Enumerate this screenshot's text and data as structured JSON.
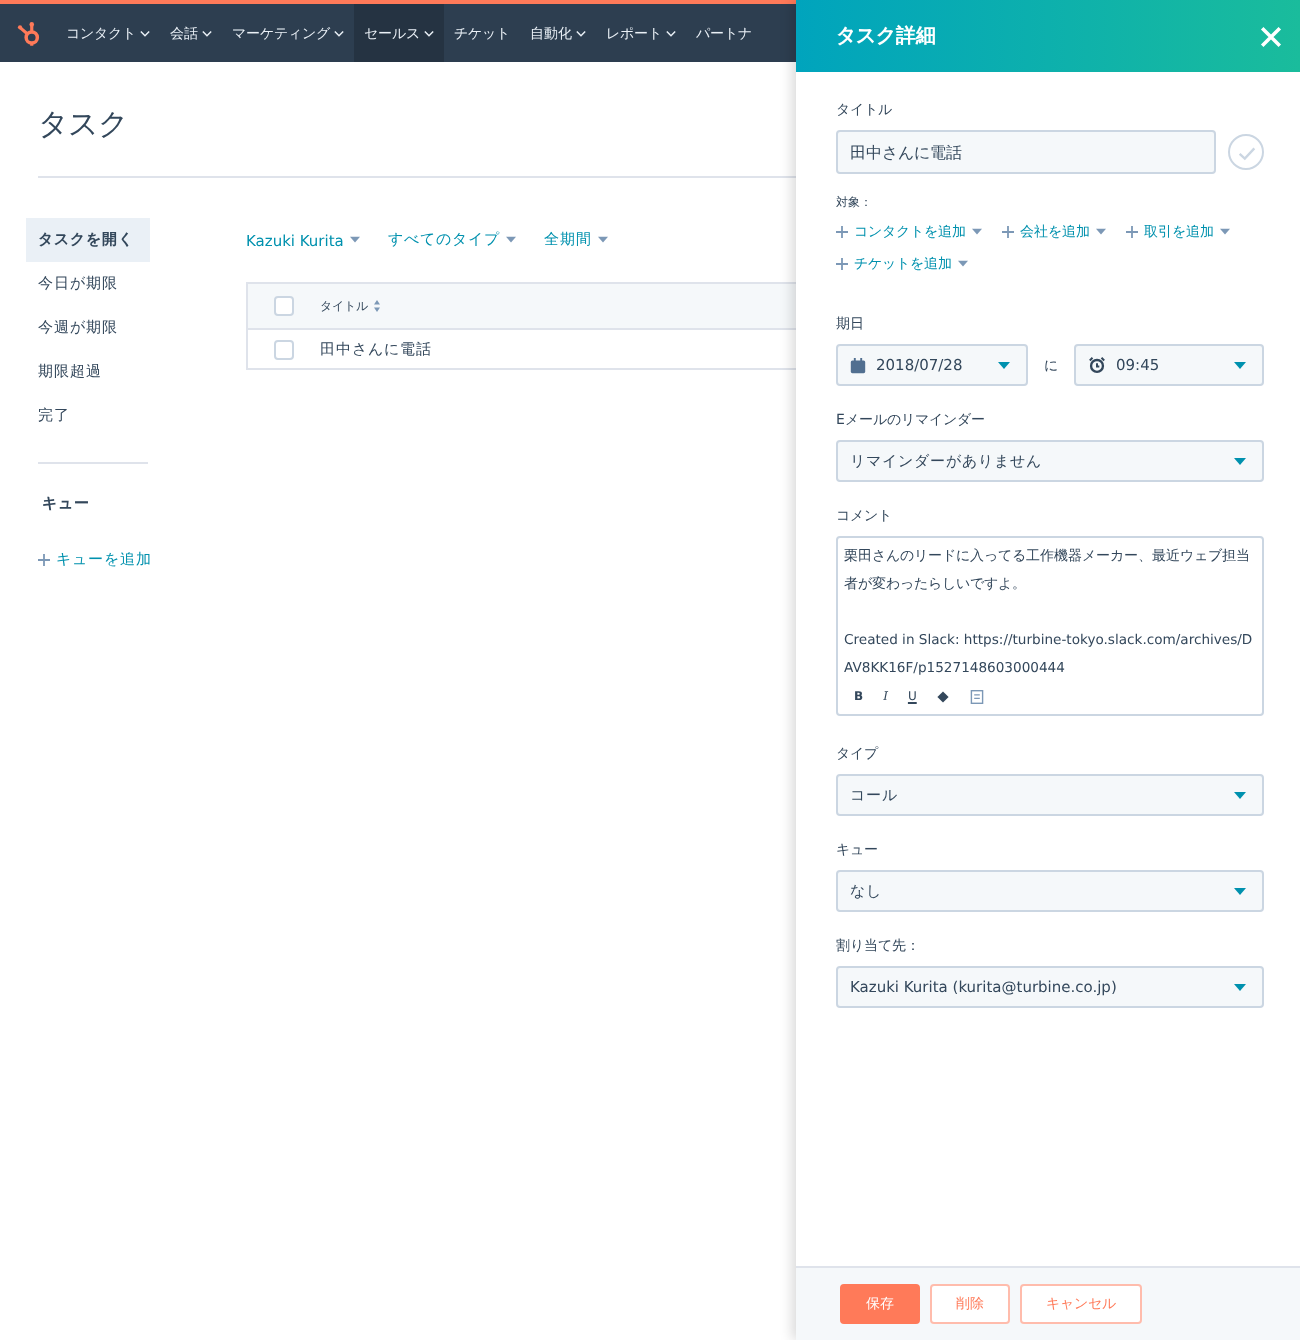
{
  "nav": {
    "items": [
      {
        "label": "コンタクト",
        "dropdown": true,
        "selected": false
      },
      {
        "label": "会話",
        "dropdown": true,
        "selected": false
      },
      {
        "label": "マーケティング",
        "dropdown": true,
        "selected": false
      },
      {
        "label": "セールス",
        "dropdown": true,
        "selected": true
      },
      {
        "label": "チケット",
        "dropdown": false,
        "selected": false
      },
      {
        "label": "自動化",
        "dropdown": true,
        "selected": false
      },
      {
        "label": "レポート",
        "dropdown": true,
        "selected": false
      },
      {
        "label": "パートナ",
        "dropdown": false,
        "selected": false
      }
    ]
  },
  "page": {
    "title": "タスク"
  },
  "sidebar": {
    "items": [
      {
        "label": "タスクを開く",
        "selected": true
      },
      {
        "label": "今日が期限",
        "selected": false
      },
      {
        "label": "今週が期限",
        "selected": false
      },
      {
        "label": "期限超過",
        "selected": false
      },
      {
        "label": "完了",
        "selected": false
      }
    ],
    "queue_heading": "キュー",
    "add_queue": "キューを追加"
  },
  "filters": [
    "Kazuki Kurita",
    "すべてのタイプ",
    "全期間"
  ],
  "table": {
    "columns": [
      "タイトル"
    ],
    "header_checked": false,
    "rows": [
      {
        "title": "田中さんに電話",
        "checked": false
      }
    ]
  },
  "panel": {
    "title": "タスク詳細",
    "title_label": "タイトル",
    "title_value": "田中さんに電話",
    "completed": false,
    "assoc_label": "対象：",
    "assoc_links": [
      "コンタクトを追加",
      "会社を追加",
      "取引を追加",
      "チケットを追加"
    ],
    "due_label": "期日",
    "due_date": "2018/07/28",
    "due_at": "に",
    "due_time": "09:45",
    "reminder_label": "Eメールのリマインダー",
    "reminder_value": "リマインダーがありません",
    "comment_label": "コメント",
    "comment_paragraphs": [
      "栗田さんのリードに入ってる工作機器メーカー、最近ウェブ担当者が変わったらしいですよ。",
      "Created in Slack: https://turbine-tokyo.slack.com/archives/DAV8KK16F/p1527148603000444"
    ],
    "format_buttons": [
      {
        "kind": "bold",
        "label": "B"
      },
      {
        "kind": "italic",
        "label": "I"
      },
      {
        "kind": "underline",
        "label": "U"
      },
      {
        "kind": "paint"
      },
      {
        "kind": "attach"
      }
    ],
    "selects": [
      {
        "label": "タイプ",
        "value": "コール"
      },
      {
        "label": "キュー",
        "value": "なし"
      },
      {
        "label": "割り当て先：",
        "value": "Kazuki Kurita (kurita@turbine.co.jp)"
      }
    ],
    "buttons": [
      {
        "label": "保存",
        "kind": "primary"
      },
      {
        "label": "削除",
        "kind": "secondary"
      },
      {
        "label": "キャンセル",
        "kind": "secondary"
      }
    ]
  }
}
